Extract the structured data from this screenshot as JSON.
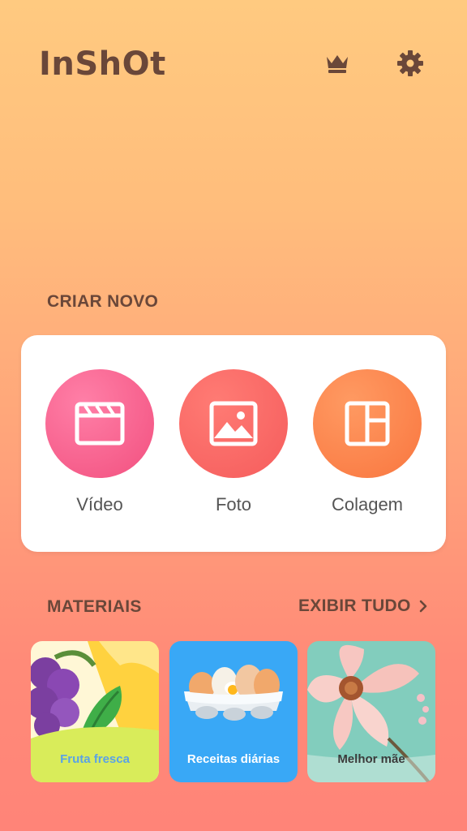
{
  "app": {
    "logo": "InShOt"
  },
  "header": {
    "crown_icon": "crown-icon",
    "gear_icon": "gear-icon"
  },
  "create": {
    "title": "CRIAR NOVO",
    "items": [
      {
        "label": "Vídeo",
        "icon": "clapperboard-icon",
        "color": "#f45a8c"
      },
      {
        "label": "Foto",
        "icon": "image-icon",
        "color": "#f86563"
      },
      {
        "label": "Colagem",
        "icon": "collage-icon",
        "color": "#fb7f4f"
      }
    ]
  },
  "materials": {
    "title": "MATERIAIS",
    "view_all": "EXIBIR TUDO",
    "items": [
      {
        "label": "Fruta fresca",
        "label_color": "#5aa2e6"
      },
      {
        "label": "Receitas diárias",
        "label_color": "#ffffff"
      },
      {
        "label": "Melhor mãe",
        "label_color": "#3b3b3b"
      }
    ]
  }
}
